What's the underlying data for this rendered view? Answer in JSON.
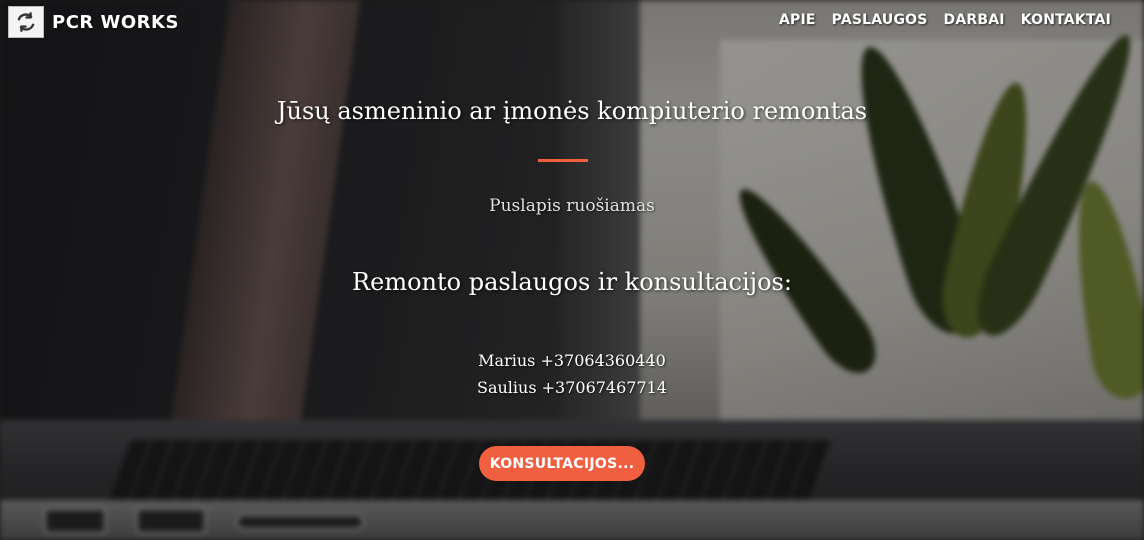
{
  "brand": {
    "name": "PCR WORKS",
    "logo_icon": "refresh-icon"
  },
  "nav": {
    "items": [
      {
        "label": "APIE"
      },
      {
        "label": "PASLAUGOS"
      },
      {
        "label": "DARBAI"
      },
      {
        "label": "KONTAKTAI"
      }
    ]
  },
  "hero": {
    "title": "Jūsų asmeninio ar įmonės kompiuterio remontas",
    "subtitle": "Puslapis ruošiamas",
    "services_heading": "Remonto paslaugos ir konsultacijos:",
    "contacts": [
      {
        "text": "Marius +37064360440"
      },
      {
        "text": "Saulius +37067467714"
      }
    ],
    "cta_label": "KONSULTACIJOS...",
    "accent_color": "#f05f40"
  }
}
